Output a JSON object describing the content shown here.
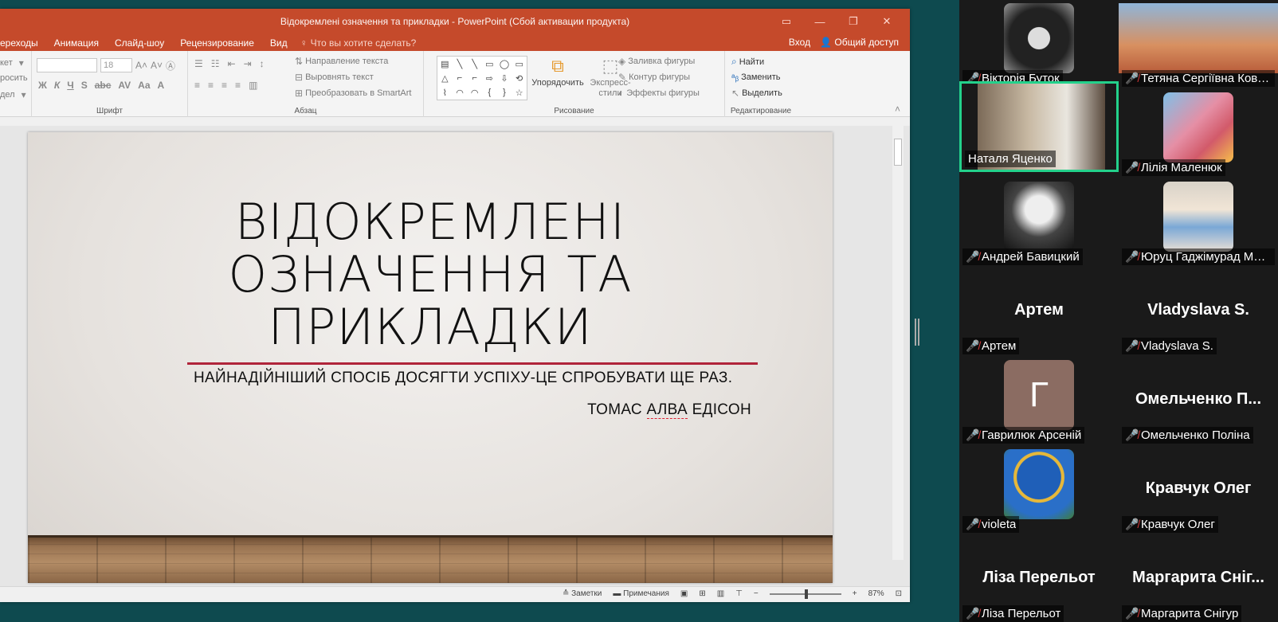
{
  "powerpoint": {
    "title": "Відокремлені означення та прикладки - PowerPoint (Сбой активации продукта)",
    "menu_tabs": [
      "ереходы",
      "Анимация",
      "Слайд-шоу",
      "Рецензирование",
      "Вид"
    ],
    "search_placeholder": "Что вы хотите сделать?",
    "signin": "Вход",
    "share": "Общий доступ",
    "ribbon": {
      "left_cut": [
        "кет",
        "росить",
        "дел"
      ],
      "font_group": "Шрифт",
      "font_size": "18",
      "paragraph_group": "Абзац",
      "text_direction": "Направление текста",
      "align_text": "Выровнять текст",
      "smartart": "Преобразовать в SmartArt",
      "drawing_group": "Рисование",
      "arrange": "Упорядочить",
      "quick_styles": "Экспресс-стили",
      "shape_fill": "Заливка фигуры",
      "shape_outline": "Контур фигуры",
      "shape_effects": "Эффекты фигуры",
      "editing_group": "Редактирование",
      "find": "Найти",
      "replace": "Заменить",
      "select": "Выделить"
    },
    "slide": {
      "title_lines": [
        "ВІДОКРЕМЛЕНІ",
        "ОЗНАЧЕННЯ ТА",
        "ПРИКЛАДКИ"
      ],
      "subtitle": "НАЙНАДІЙНІШИЙ СПОСІБ ДОСЯГТИ УСПІХУ-ЦЕ СПРОБУВАТИ ЩЕ РАЗ.",
      "author_a": "ТОМАС ",
      "author_b": "АЛВА",
      "author_c": " ЕДІСОН"
    },
    "status": {
      "notes": "Заметки",
      "comments": "Примечания",
      "zoom": "87%"
    }
  },
  "participants": [
    {
      "name": "Вікторія Буток",
      "has_photo": true
    },
    {
      "name": "Тетяна Сергіївна Кова...",
      "has_photo": true
    },
    {
      "name": "Наталя Яценко",
      "has_photo": true,
      "active": true
    },
    {
      "name": "Лілія Маленюк",
      "has_photo": true
    },
    {
      "name": "Андрей Бавицкий",
      "has_photo": true
    },
    {
      "name": "Юруц Гаджімурад МЛ№...",
      "has_photo": true
    },
    {
      "name": "Артем",
      "big_name": "Артем"
    },
    {
      "name": "Vladyslava S.",
      "big_name": "Vladyslava S."
    },
    {
      "name": "Гаврилюк Арсеній",
      "letter": "Г"
    },
    {
      "name": "Омельченко Поліна",
      "big_name": "Омельченко П..."
    },
    {
      "name": "violeta",
      "has_photo": true
    },
    {
      "name": "Кравчук Олег",
      "big_name": "Кравчук Олег"
    },
    {
      "name": "Ліза Перельот",
      "big_name": "Ліза Перельот"
    },
    {
      "name": "Маргарита Снігур",
      "big_name": "Маргарита Сніг..."
    }
  ]
}
